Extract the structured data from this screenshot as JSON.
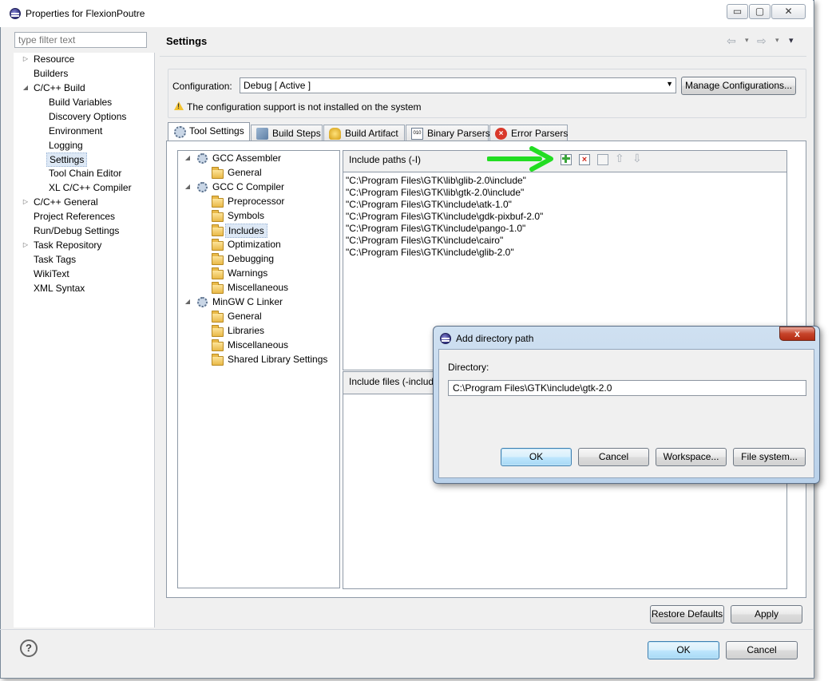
{
  "window": {
    "title": "Properties for FlexionPoutre",
    "minimize": "▭",
    "maximize": "▢",
    "close": "✕"
  },
  "left": {
    "filter_placeholder": "type filter text",
    "items": [
      {
        "label": "Resource"
      },
      {
        "label": "Builders"
      },
      {
        "label": "C/C++ Build"
      },
      {
        "label": "Build Variables"
      },
      {
        "label": "Discovery Options"
      },
      {
        "label": "Environment"
      },
      {
        "label": "Logging"
      },
      {
        "label": "Settings"
      },
      {
        "label": "Tool Chain Editor"
      },
      {
        "label": "XL C/C++ Compiler"
      },
      {
        "label": "C/C++ General"
      },
      {
        "label": "Project References"
      },
      {
        "label": "Run/Debug Settings"
      },
      {
        "label": "Task Repository"
      },
      {
        "label": "Task Tags"
      },
      {
        "label": "WikiText"
      },
      {
        "label": "XML Syntax"
      }
    ]
  },
  "main": {
    "title": "Settings",
    "nav_back": "⇦",
    "nav_forward": "⇨",
    "nav_dropdown": "▾",
    "config_label": "Configuration:",
    "config_value": "Debug  [ Active ]",
    "manage_button": "Manage Configurations...",
    "warning": "The configuration support is not installed on the system",
    "tabs": [
      {
        "label": "Tool Settings"
      },
      {
        "label": "Build Steps"
      },
      {
        "label": "Build Artifact"
      },
      {
        "label": "Binary Parsers"
      },
      {
        "label": "Error Parsers"
      }
    ],
    "tool_tree": [
      {
        "label": "GCC Assembler"
      },
      {
        "label": "General"
      },
      {
        "label": "GCC C Compiler"
      },
      {
        "label": "Preprocessor"
      },
      {
        "label": "Symbols"
      },
      {
        "label": "Includes"
      },
      {
        "label": "Optimization"
      },
      {
        "label": "Debugging"
      },
      {
        "label": "Warnings"
      },
      {
        "label": "Miscellaneous"
      },
      {
        "label": "MinGW C Linker"
      },
      {
        "label": "General"
      },
      {
        "label": "Libraries"
      },
      {
        "label": "Miscellaneous"
      },
      {
        "label": "Shared Library Settings"
      }
    ],
    "include_paths_label": "Include paths (-I)",
    "include_paths": [
      "\"C:\\Program Files\\GTK\\lib\\glib-2.0\\include\"",
      "\"C:\\Program Files\\GTK\\lib\\gtk-2.0\\include\"",
      "\"C:\\Program Files\\GTK\\include\\atk-1.0\"",
      "\"C:\\Program Files\\GTK\\include\\gdk-pixbuf-2.0\"",
      "\"C:\\Program Files\\GTK\\include\\pango-1.0\"",
      "\"C:\\Program Files\\GTK\\include\\cairo\"",
      "\"C:\\Program Files\\GTK\\include\\glib-2.0\""
    ],
    "include_files_label": "Include files (-include)",
    "restore_defaults": "Restore Defaults",
    "apply": "Apply"
  },
  "dialog": {
    "title": "Add directory path",
    "close": "x",
    "directory_label": "Directory:",
    "directory_value": "C:\\Program Files\\GTK\\include\\gtk-2.0",
    "ok": "OK",
    "cancel": "Cancel",
    "workspace": "Workspace...",
    "file_system": "File system..."
  },
  "footer": {
    "help": "?",
    "ok": "OK",
    "cancel": "Cancel"
  },
  "colors": {
    "annotation_arrow": "#22dd22",
    "selection": "#dde8f5"
  }
}
